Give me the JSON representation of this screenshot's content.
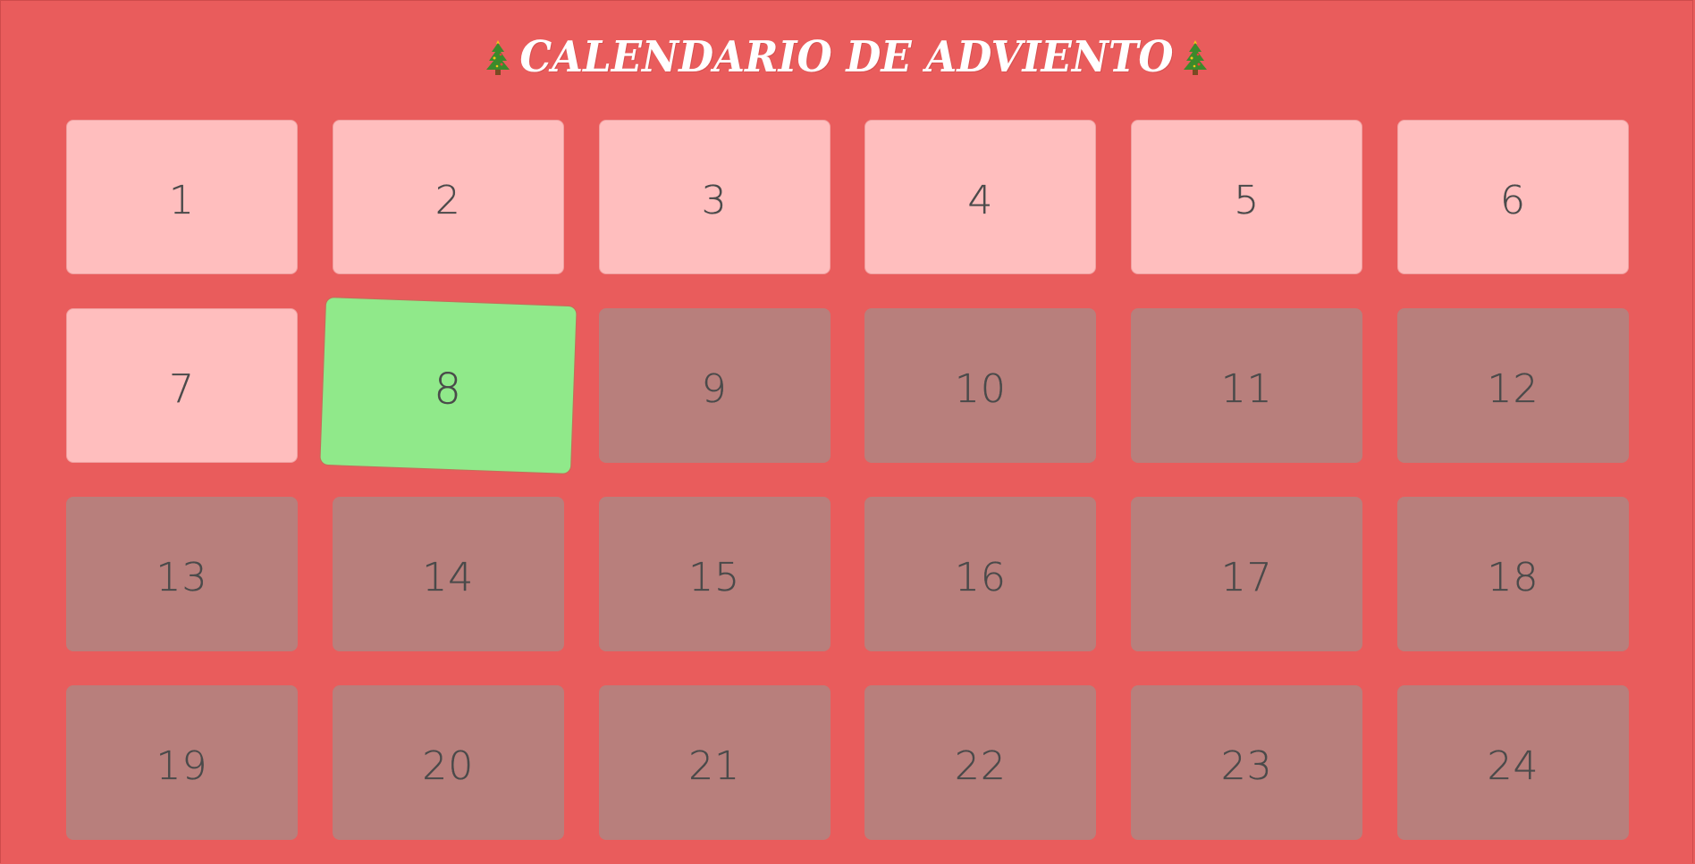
{
  "header": {
    "title": "CALENDARIO DE ADVIENTO",
    "left_icon": "christmas-tree-icon",
    "right_icon": "christmas-tree-icon"
  },
  "colors": {
    "background": "#e95c5c",
    "opened_door": "#ffbebe",
    "today_door": "#90e98a",
    "locked_door": "#b87f7c",
    "number_text": "#4a4a4a",
    "title_text": "#ffffff"
  },
  "days": [
    {
      "label": "1",
      "state": "opened"
    },
    {
      "label": "2",
      "state": "opened"
    },
    {
      "label": "3",
      "state": "opened"
    },
    {
      "label": "4",
      "state": "opened"
    },
    {
      "label": "5",
      "state": "opened"
    },
    {
      "label": "6",
      "state": "opened"
    },
    {
      "label": "7",
      "state": "opened"
    },
    {
      "label": "8",
      "state": "today"
    },
    {
      "label": "9",
      "state": "locked"
    },
    {
      "label": "10",
      "state": "locked"
    },
    {
      "label": "11",
      "state": "locked"
    },
    {
      "label": "12",
      "state": "locked"
    },
    {
      "label": "13",
      "state": "locked"
    },
    {
      "label": "14",
      "state": "locked"
    },
    {
      "label": "15",
      "state": "locked"
    },
    {
      "label": "16",
      "state": "locked"
    },
    {
      "label": "17",
      "state": "locked"
    },
    {
      "label": "18",
      "state": "locked"
    },
    {
      "label": "19",
      "state": "locked"
    },
    {
      "label": "20",
      "state": "locked"
    },
    {
      "label": "21",
      "state": "locked"
    },
    {
      "label": "22",
      "state": "locked"
    },
    {
      "label": "23",
      "state": "locked"
    },
    {
      "label": "24",
      "state": "locked"
    }
  ]
}
